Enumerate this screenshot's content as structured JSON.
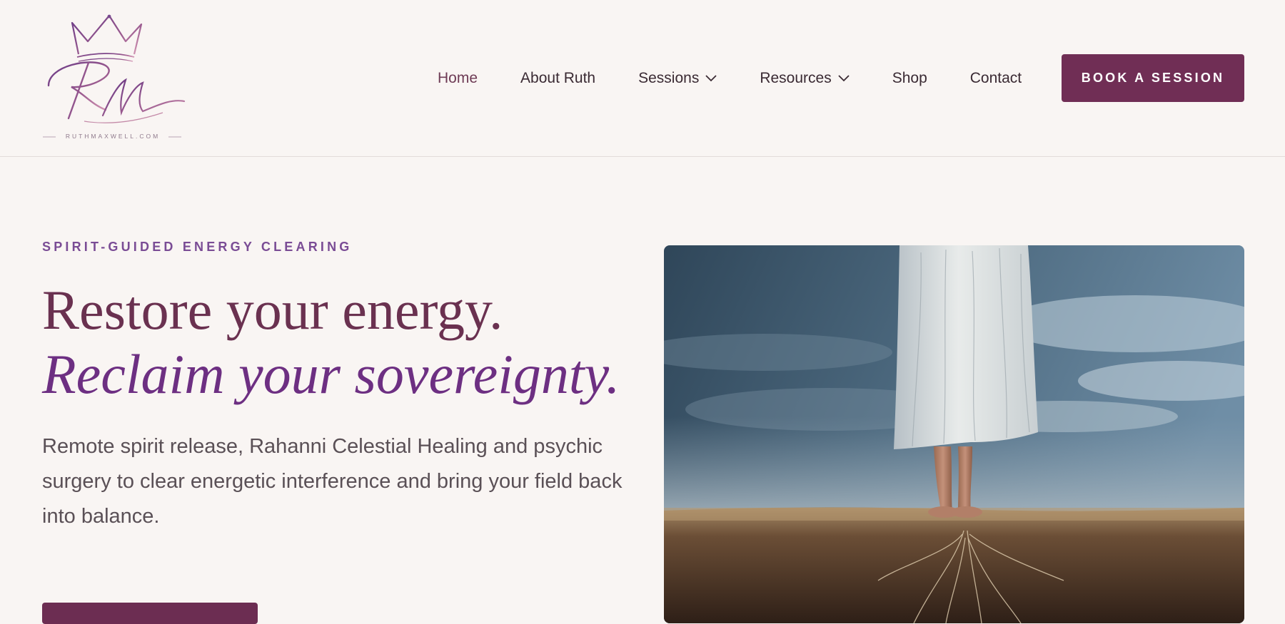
{
  "header": {
    "logo": {
      "monogram": "RM",
      "domain": "RUTHMAXWELL.COM"
    },
    "nav": [
      {
        "label": "Home",
        "active": true,
        "dropdown": false
      },
      {
        "label": "About Ruth",
        "active": false,
        "dropdown": false
      },
      {
        "label": "Sessions",
        "active": false,
        "dropdown": true
      },
      {
        "label": "Resources",
        "active": false,
        "dropdown": true
      },
      {
        "label": "Shop",
        "active": false,
        "dropdown": false
      },
      {
        "label": "Contact",
        "active": false,
        "dropdown": false
      }
    ],
    "cta_label": "BOOK A SESSION"
  },
  "hero": {
    "eyebrow": "SPIRIT-GUIDED ENERGY CLEARING",
    "headline_line1": "Restore your energy.",
    "headline_line2": "Reclaim your sovereignty.",
    "lede": "Remote spirit release, Rahanni Celestial Healing and psychic surgery to clear energetic interference and bring your field back into balance.",
    "image_subject": "barefoot-woman-white-dress-over-earth-roots"
  },
  "colors": {
    "background": "#f9f5f3",
    "brand_plum": "#702e55",
    "headline_plum": "#6a3150",
    "headline_purple": "#6d2f82",
    "eyebrow_purple": "#7a4c95",
    "body_text": "#5a5056",
    "nav_text": "#3a2a33"
  }
}
